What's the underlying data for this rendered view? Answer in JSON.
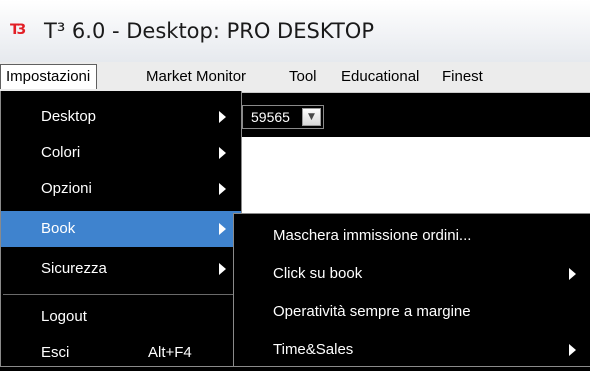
{
  "app": {
    "logo_text": "T3",
    "title": "T³ 6.0 - Desktop: PRO DESKTOP"
  },
  "menubar": {
    "items": [
      {
        "label": "Impostazioni"
      },
      {
        "label": "Market Monitor"
      },
      {
        "label": "Tool"
      },
      {
        "label": "Educational"
      },
      {
        "label": "Finest"
      }
    ]
  },
  "toolbar": {
    "combo_value": "59565"
  },
  "impostazioni_menu": {
    "items": [
      {
        "label": "Desktop"
      },
      {
        "label": "Colori"
      },
      {
        "label": "Opzioni"
      },
      {
        "label": "Book"
      },
      {
        "label": "Sicurezza"
      },
      {
        "label": "Logout"
      },
      {
        "label": "Esci",
        "shortcut": "Alt+F4"
      }
    ]
  },
  "book_submenu": {
    "items": [
      {
        "label": "Maschera immissione ordini..."
      },
      {
        "label": "Click su book"
      },
      {
        "label": "Operatività sempre a margine"
      },
      {
        "label": "Time&Sales"
      }
    ]
  },
  "colors": {
    "highlight": "#3f83ce",
    "menu_background": "#000000",
    "logo": "#e21f26"
  },
  "icons": [
    "app-logo-icon",
    "dropdown-arrow-icon",
    "submenu-arrow-icon"
  ]
}
